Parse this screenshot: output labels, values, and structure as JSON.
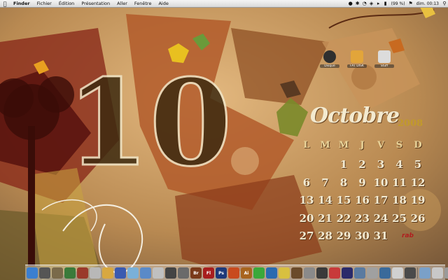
{
  "menubar": {
    "app_name": "Finder",
    "menus": [
      "Fichier",
      "Édition",
      "Présentation",
      "Aller",
      "Fenêtre",
      "Aide"
    ],
    "battery": "(99 %)",
    "clock": "dim. 00:13"
  },
  "desktop_icons": [
    {
      "label": "Disque",
      "icon": "hard-drive-icon",
      "color": "#2f2f2f"
    },
    {
      "label": "FAT DISK",
      "icon": "folder-icon",
      "color": "#e2a53a"
    },
    {
      "label": "Stuff",
      "icon": "document-icon",
      "color": "#dcdcdc"
    }
  ],
  "calendar": {
    "month": "Octobre",
    "year": "2008",
    "weekdays": [
      "L",
      "M",
      "M",
      "J",
      "V",
      "S",
      "D"
    ],
    "weeks": [
      [
        "",
        "",
        "1",
        "2",
        "3",
        "4",
        "5"
      ],
      [
        "6",
        "7",
        "8",
        "9",
        "10",
        "11",
        "12"
      ],
      [
        "13",
        "14",
        "15",
        "16",
        "17",
        "18",
        "19"
      ],
      [
        "20",
        "21",
        "22",
        "23",
        "24",
        "25",
        "26"
      ],
      [
        "27",
        "28",
        "29",
        "30",
        "31",
        "",
        ""
      ]
    ],
    "signature": "rab"
  },
  "wallpaper": {
    "big_number": "10"
  },
  "dock": {
    "items": [
      {
        "name": "finder-icon",
        "color": "#3b7fd0",
        "text": ""
      },
      {
        "name": "dashboard-icon",
        "color": "#555555",
        "text": ""
      },
      {
        "name": "app-icon",
        "color": "#7a6a4a",
        "text": ""
      },
      {
        "name": "app-icon",
        "color": "#3a7a3a",
        "text": ""
      },
      {
        "name": "app-icon",
        "color": "#9a3a2a",
        "text": ""
      },
      {
        "name": "app-icon",
        "color": "#b8b8b8",
        "text": ""
      },
      {
        "name": "app-icon",
        "color": "#d8a840",
        "text": ""
      },
      {
        "name": "app-icon",
        "color": "#3a5ab0",
        "text": ""
      },
      {
        "name": "app-icon",
        "color": "#7ab0d8",
        "text": ""
      },
      {
        "name": "app-icon",
        "color": "#5a8ac8",
        "text": ""
      },
      {
        "name": "app-icon",
        "color": "#c0c0c0",
        "text": ""
      },
      {
        "name": "app-icon",
        "color": "#444444",
        "text": ""
      },
      {
        "name": "app-icon",
        "color": "#6a6a6a",
        "text": ""
      },
      {
        "name": "bridge-icon",
        "color": "#7a3a1a",
        "text": "Br"
      },
      {
        "name": "flash-icon",
        "color": "#a81e1e",
        "text": "Fl"
      },
      {
        "name": "photoshop-icon",
        "color": "#1e3a7a",
        "text": "Ps"
      },
      {
        "name": "app-icon",
        "color": "#c84a1e",
        "text": ""
      },
      {
        "name": "illustrator-icon",
        "color": "#a8641e",
        "text": "Ai"
      },
      {
        "name": "app-icon",
        "color": "#3aa83a",
        "text": ""
      },
      {
        "name": "app-icon",
        "color": "#2a6ab0",
        "text": ""
      },
      {
        "name": "app-icon",
        "color": "#d8c040",
        "text": ""
      },
      {
        "name": "app-icon",
        "color": "#6a4a2a",
        "text": ""
      },
      {
        "name": "app-icon",
        "color": "#8a8a8a",
        "text": ""
      },
      {
        "name": "app-icon",
        "color": "#3a3a3a",
        "text": ""
      },
      {
        "name": "app-icon",
        "color": "#c83a3a",
        "text": ""
      },
      {
        "name": "app-icon",
        "color": "#2a2a6a",
        "text": ""
      },
      {
        "name": "app-icon",
        "color": "#5a7aa0",
        "text": ""
      },
      {
        "name": "app-icon",
        "color": "#a0a0a0",
        "text": ""
      },
      {
        "name": "app-icon",
        "color": "#3a6a9a",
        "text": ""
      },
      {
        "name": "app-icon",
        "color": "#d0d0d0",
        "text": ""
      },
      {
        "name": "app-icon",
        "color": "#4a4a4a",
        "text": ""
      }
    ],
    "trailing_items": [
      {
        "name": "app-icon",
        "color": "#7aa0c8",
        "text": ""
      },
      {
        "name": "documents-stack-icon",
        "color": "#c8c8c8",
        "text": ""
      },
      {
        "name": "trash-icon",
        "color": "#9a9a9a",
        "text": ""
      }
    ]
  },
  "colors": {
    "wallpaper_base": "#b98a52",
    "calendar_text": "#f2ead2",
    "calendar_year": "#c29a2a",
    "signature": "#b01e1e"
  }
}
